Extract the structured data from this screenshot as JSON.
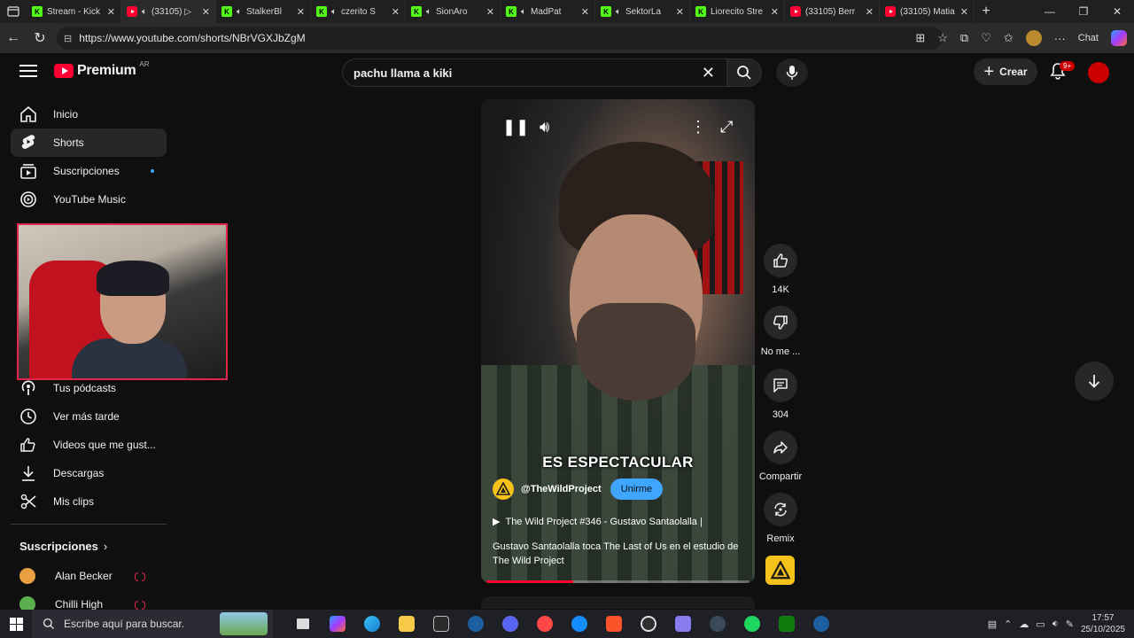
{
  "browser": {
    "tabs": [
      {
        "favicon": "kick",
        "audio": false,
        "title": "Stream - Kick",
        "active": false
      },
      {
        "favicon": "youtube",
        "audio": true,
        "title": "(33105) ▷",
        "active": true
      },
      {
        "favicon": "kick",
        "audio": true,
        "title": "StalkerBl",
        "active": false
      },
      {
        "favicon": "kick",
        "audio": true,
        "title": "czerito S",
        "active": false
      },
      {
        "favicon": "kick",
        "audio": true,
        "title": "SionAro",
        "active": false
      },
      {
        "favicon": "kick",
        "audio": true,
        "title": "MadPat",
        "active": false
      },
      {
        "favicon": "kick",
        "audio": true,
        "title": "SektorLa",
        "active": false
      },
      {
        "favicon": "kick",
        "audio": false,
        "title": "Liorecito Stre",
        "active": false
      },
      {
        "favicon": "youtube",
        "audio": false,
        "title": "(33105) Berr",
        "active": false
      },
      {
        "favicon": "youtube",
        "audio": false,
        "title": "(33105) Matia",
        "active": false
      }
    ],
    "url": "https://www.youtube.com/shorts/NBrVGXJbZgM",
    "chat_label": "Chat"
  },
  "youtube": {
    "logo_word": "Premium",
    "country_code": "AR",
    "search_query": "pachu llama a kiki",
    "create_label": "Crear",
    "notif_badge": "9+",
    "accent": "#ff0033"
  },
  "sidebar": {
    "items": [
      {
        "icon": "home-icon",
        "label": "Inicio"
      },
      {
        "icon": "shorts-icon",
        "label": "Shorts"
      },
      {
        "icon": "subscriptions-icon",
        "label": "Suscripciones"
      },
      {
        "icon": "youtube-music-icon",
        "label": "YouTube Music"
      }
    ],
    "items2": [
      {
        "icon": "podcast-icon",
        "label": "Tus pódcasts"
      },
      {
        "icon": "clock-icon",
        "label": "Ver más tarde"
      },
      {
        "icon": "like-icon",
        "label": "Videos que me gust..."
      },
      {
        "icon": "download-icon",
        "label": "Descargas"
      },
      {
        "icon": "scissors-icon",
        "label": "Mis clips"
      }
    ],
    "subs_heading": "Suscripciones",
    "subs": [
      {
        "name": "Alan Becker",
        "live": true,
        "color": "#e8a040"
      },
      {
        "name": "Chilli High",
        "live": true,
        "color": "#5ab04c"
      }
    ]
  },
  "short": {
    "caption": "ES ESPECTACULAR",
    "channel": "@TheWildProject",
    "join_label": "Unirme",
    "title": "The Wild Project #346 - Gustavo Santaolalla |",
    "description": "Gustavo Santaolalla toca The Last of Us en el estudio de The Wild Project",
    "progress": 0.33
  },
  "actions": {
    "likes": "14K",
    "dislike_label": "No me ...",
    "comments": "304",
    "share_label": "Compartir",
    "remix_label": "Remix"
  },
  "taskbar": {
    "search_placeholder": "Escribe aquí para buscar.",
    "time": "17:57",
    "date": "25/10/2025"
  }
}
